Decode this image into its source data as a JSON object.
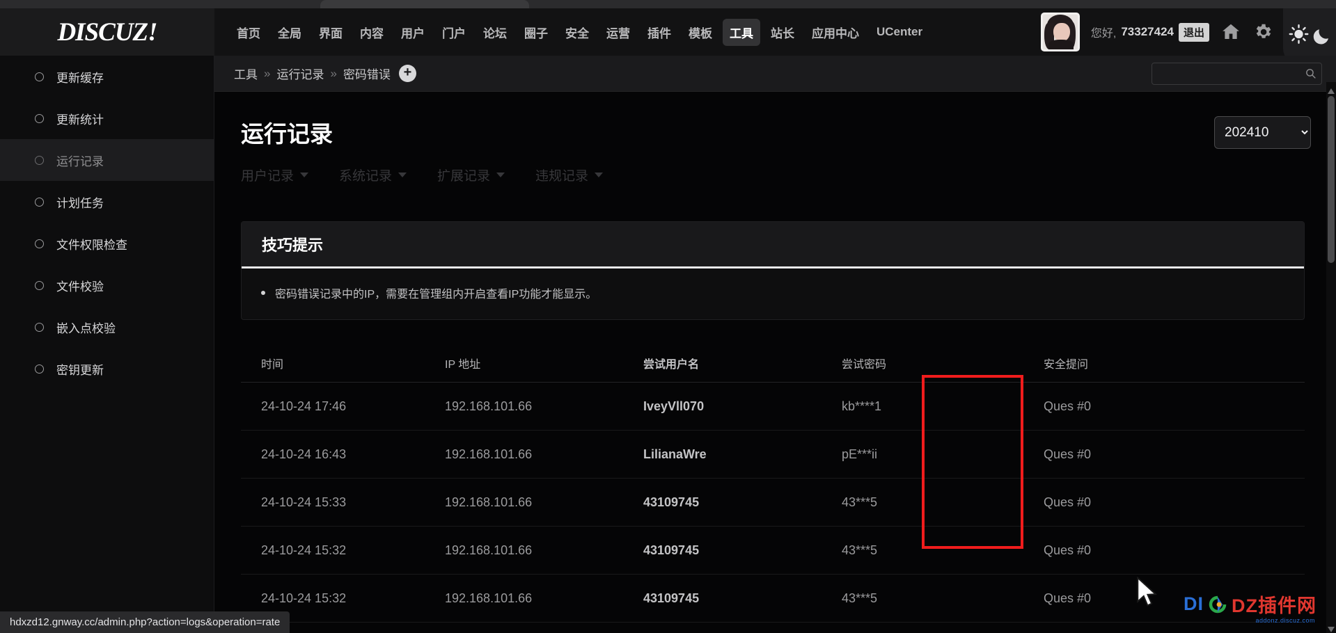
{
  "brand": {
    "logo": "DISCUZ!"
  },
  "nav": {
    "items": [
      {
        "label": "首页",
        "active": false
      },
      {
        "label": "全局",
        "active": false
      },
      {
        "label": "界面",
        "active": false
      },
      {
        "label": "内容",
        "active": false
      },
      {
        "label": "用户",
        "active": false
      },
      {
        "label": "门户",
        "active": false
      },
      {
        "label": "论坛",
        "active": false
      },
      {
        "label": "圈子",
        "active": false
      },
      {
        "label": "安全",
        "active": false
      },
      {
        "label": "运营",
        "active": false
      },
      {
        "label": "插件",
        "active": false
      },
      {
        "label": "模板",
        "active": false
      },
      {
        "label": "工具",
        "active": true
      },
      {
        "label": "站长",
        "active": false
      },
      {
        "label": "应用中心",
        "active": false
      },
      {
        "label": "UCenter",
        "active": false
      }
    ]
  },
  "account": {
    "greeting": "您好,",
    "username": "73327424",
    "logout_label": "退出",
    "avatar_name": "user-avatar"
  },
  "header_icons": [
    {
      "name": "home-icon"
    },
    {
      "name": "gear-icon"
    },
    {
      "name": "sun-moon-theme-toggle-icon"
    }
  ],
  "sidebar": {
    "items": [
      {
        "label": "更新缓存",
        "active": false
      },
      {
        "label": "更新统计",
        "active": false
      },
      {
        "label": "运行记录",
        "active": true
      },
      {
        "label": "计划任务",
        "active": false
      },
      {
        "label": "文件权限检查",
        "active": false
      },
      {
        "label": "文件校验",
        "active": false
      },
      {
        "label": "嵌入点校验",
        "active": false
      },
      {
        "label": "密钥更新",
        "active": false
      }
    ]
  },
  "breadcrumb": {
    "items": [
      "工具",
      "运行记录",
      "密码错误"
    ],
    "separator": "»",
    "add_button_label": "+"
  },
  "search": {
    "placeholder": "",
    "value": "",
    "icon": "search-icon"
  },
  "main": {
    "title": "运行记录",
    "period": {
      "value": "202410",
      "options": [
        "202410"
      ]
    },
    "tabs": [
      {
        "label": "用户记录",
        "has_dropdown": true
      },
      {
        "label": "系统记录",
        "has_dropdown": true
      },
      {
        "label": "扩展记录",
        "has_dropdown": true
      },
      {
        "label": "违规记录",
        "has_dropdown": true
      }
    ]
  },
  "tips_card": {
    "title": "技巧提示",
    "items": [
      "密码错误记录中的IP，需要在管理组内开启查看IP功能才能显示。"
    ]
  },
  "table": {
    "columns": [
      "时间",
      "IP 地址",
      "尝试用户名",
      "尝试密码",
      "安全提问"
    ],
    "highlighted_column": "尝试密码",
    "highlight_color": "#f01c1c",
    "rows": [
      {
        "time": "24-10-24 17:46",
        "ip": "192.168.101.66",
        "username": "IveyVll070",
        "password": "kb****1",
        "question": "Ques #0"
      },
      {
        "time": "24-10-24 16:43",
        "ip": "192.168.101.66",
        "username": "LilianaWre",
        "password": "pE***ii",
        "question": "Ques #0"
      },
      {
        "time": "24-10-24 15:33",
        "ip": "192.168.101.66",
        "username": "43109745",
        "password": "43***5",
        "question": "Ques #0"
      },
      {
        "time": "24-10-24 15:32",
        "ip": "192.168.101.66",
        "username": "43109745",
        "password": "43***5",
        "question": "Ques #0"
      },
      {
        "time": "24-10-24 15:32",
        "ip": "192.168.101.66",
        "username": "43109745",
        "password": "43***5",
        "question": "Ques #0"
      }
    ]
  },
  "watermark": {
    "part1": "DI",
    "part2": "DZ插件网",
    "sub": "addonz.discuz.com"
  },
  "statusbar": {
    "url": "hdxzd12.gnway.cc/admin.php?action=logs&operation=rate"
  }
}
